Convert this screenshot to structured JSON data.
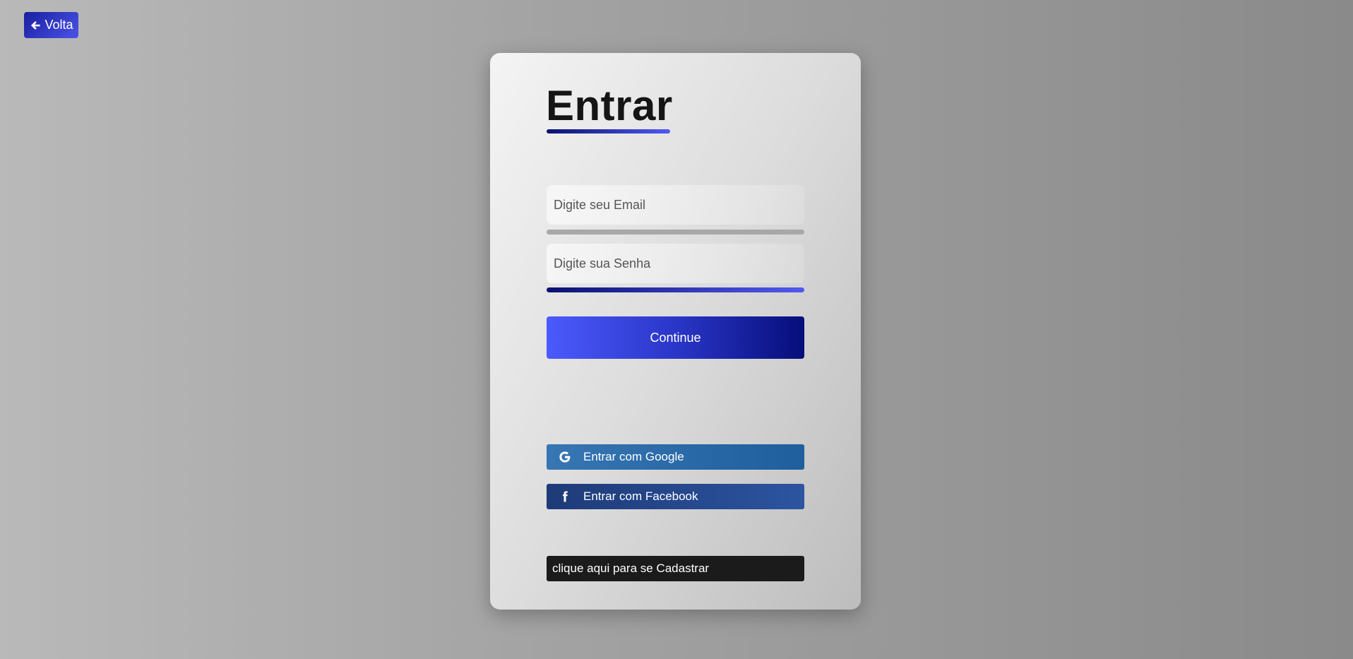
{
  "back_button": {
    "label": "Volta",
    "icon": "arrow-left-icon"
  },
  "login": {
    "title": "Entrar",
    "email_placeholder": "Digite seu Email",
    "password_placeholder": "Digite sua Senha",
    "continue_label": "Continue"
  },
  "social": {
    "google_label": "Entrar com Google",
    "google_icon": "google-icon",
    "facebook_label": "Entrar com Facebook",
    "facebook_icon": "facebook-icon"
  },
  "register_label": "clique aqui para se Cadastrar",
  "colors": {
    "accent_dark": "#0a1170",
    "accent_light": "#5159f0",
    "google": "#2a6aa8",
    "facebook": "#2a4a8c",
    "register": "#1b1b1b"
  }
}
